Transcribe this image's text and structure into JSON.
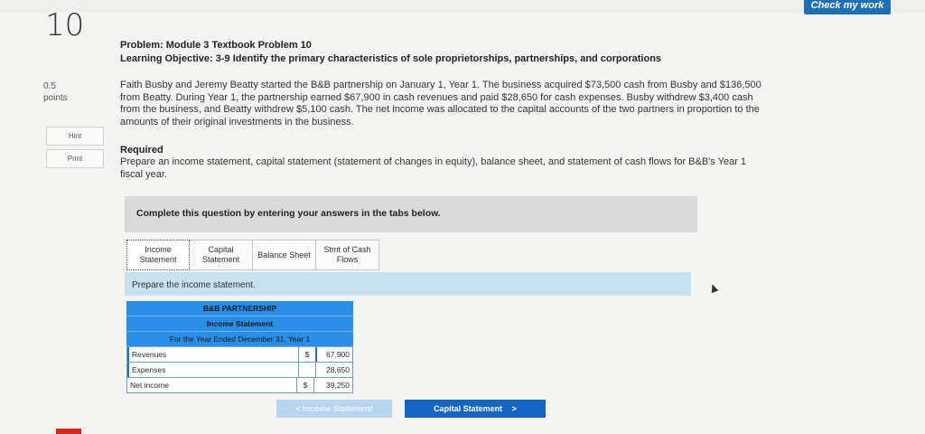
{
  "header": {
    "check_label": "Check my work"
  },
  "question": {
    "number": "10",
    "points_value": "0.5",
    "points_label": "points",
    "hint_label": "Hint",
    "print_label": "Print"
  },
  "problem": {
    "title": "Problem: Module 3 Textbook Problem 10",
    "objective": "Learning Objective: 3-9 Identify the primary characteristics of sole proprietorships, partnerships, and corporations",
    "text": "Faith Busby and Jeremy Beatty started the B&B partnership on January 1, Year 1. The business acquired $73,500 cash from Busby and $136,500 from Beatty. During Year 1, the partnership earned $67,900 in cash revenues and paid $28,650 for cash expenses. Busby withdrew $3,400 cash from the business, and Beatty withdrew $5,100 cash. The net income was allocated to the capital accounts of the two partners in proportion to the amounts of their original investments in the business.",
    "required_heading": "Required",
    "required_text": "Prepare an income statement, capital statement (statement of changes in equity), balance sheet, and statement of cash flows for B&B's Year 1 fiscal year."
  },
  "instructions": "Complete this question by entering your answers in the tabs below.",
  "tabs": [
    {
      "label": "Income Statement",
      "active": true
    },
    {
      "label": "Capital Statement",
      "active": false
    },
    {
      "label": "Balance Sheet",
      "active": false
    },
    {
      "label": "Stmt of Cash Flows",
      "active": false
    }
  ],
  "prep_text": "Prepare the income statement.",
  "statement": {
    "company": "B&B PARTNERSHIP",
    "name": "Income Statement",
    "period": "For the Year Ended December 31, Year 1",
    "rows": [
      {
        "label": "Revenues",
        "currency": "$",
        "value": "67,900"
      },
      {
        "label": "Expenses",
        "currency": "",
        "value": "28,650"
      },
      {
        "label": "Net income",
        "currency": "$",
        "value": "39,250"
      }
    ]
  },
  "nav": {
    "prev_label": "Income Statement",
    "next_label": "Capital Statement",
    "prev_arrow": "<",
    "next_arrow": ">"
  },
  "colors": {
    "accent": "#1565c4",
    "table_header": "#2a8ee8",
    "prep_bar": "#c7e1f0",
    "logo": "#d7261e"
  }
}
